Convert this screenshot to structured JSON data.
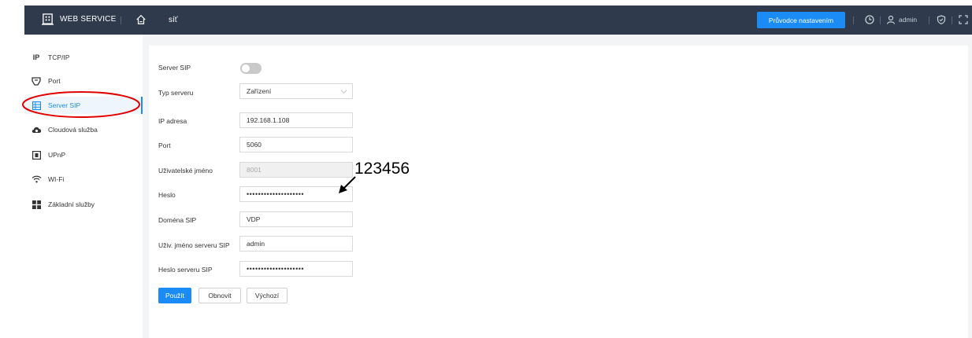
{
  "topbar": {
    "brand": "WEB SERVICE",
    "page_title": "síť",
    "wizard_button": "Průvodce nastavením",
    "user": "admin"
  },
  "sidebar": {
    "items": [
      {
        "label": "TCP/IP",
        "icon": "ip-icon"
      },
      {
        "label": "Port",
        "icon": "port-icon"
      },
      {
        "label": "Server SIP",
        "icon": "server-icon",
        "active": true
      },
      {
        "label": "Cloudová služba",
        "icon": "cloud-icon"
      },
      {
        "label": "UPnP",
        "icon": "upnp-icon"
      },
      {
        "label": "WI-Fi",
        "icon": "wifi-icon"
      },
      {
        "label": "Základní služby",
        "icon": "services-icon"
      }
    ]
  },
  "form": {
    "server_sip": {
      "label": "Server SIP",
      "enabled": false
    },
    "server_type": {
      "label": "Typ serveru",
      "value": "Zařízení"
    },
    "ip": {
      "label": "IP adresa",
      "value": "192.168.1.108"
    },
    "port": {
      "label": "Port",
      "value": "5060"
    },
    "username": {
      "label": "Uživatelské jméno",
      "value": "8001"
    },
    "password": {
      "label": "Heslo",
      "value": "••••••••••••••••••••"
    },
    "domain": {
      "label": "Doména SIP",
      "value": "VDP"
    },
    "server_user": {
      "label": "Uživ. jméno serveru SIP",
      "value": "admin"
    },
    "server_password": {
      "label": "Heslo serveru SIP",
      "value": "••••••••••••••••••••"
    }
  },
  "buttons": {
    "apply": "Použít",
    "refresh": "Obnovit",
    "default": "Výchozí"
  },
  "annotation": {
    "text": "123456",
    "color": "#e00000"
  },
  "colors": {
    "topbar": "#2f3b4c",
    "accent": "#1b8cf5"
  }
}
